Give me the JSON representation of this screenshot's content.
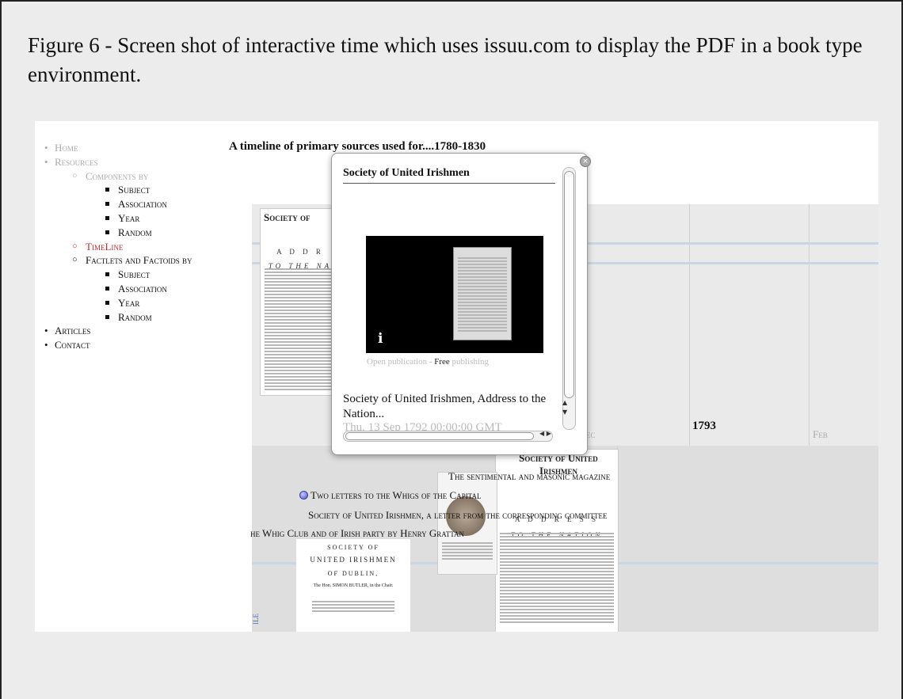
{
  "caption": "Figure 6 - Screen shot of interactive time which uses issuu.com to display the PDF in a book type environment.",
  "nav": {
    "home": "Home",
    "resources": "Resources",
    "components_by": "Components by",
    "components_items": [
      "Subject",
      "Association",
      "Year",
      "Random"
    ],
    "timeline": "TimeLine",
    "factlets": "Factlets and Factoids by",
    "factlets_items": [
      "Subject",
      "Association",
      "Year",
      "Random"
    ],
    "articles": "Articles",
    "contact": "Contact"
  },
  "page_heading": "A timeline of primary sources used for....1780-1830",
  "timeline": {
    "year_label": "1793",
    "month_labels": [
      "ec",
      "Feb"
    ],
    "doc_cards": [
      {
        "title": "Society of",
        "sub": "A D D R",
        "sub2": "TO THE NA"
      },
      {
        "title": "Society of United Irishmen",
        "sub": "A D D R E S S",
        "sub2": "TO THE NATION"
      }
    ],
    "doc3_lines": [
      "SOCIETY OF",
      "UNITED IRISHMEN",
      "OF DUBLIN,",
      "The Hon. SIMON BUTLER, in the Chair."
    ],
    "events": [
      "The sentimental and masonic magazine",
      "Two letters to the Whigs of the Capital",
      "Society of United Irishmen, a letter from the corresponding committee",
      "he Whig Club and of Irish party by Henry Grattan"
    ],
    "side_flag": "ILE"
  },
  "popup": {
    "title": "Society of United Irishmen",
    "info_glyph": "i",
    "open_link": "Open publication",
    "free_label": "Free",
    "publishing_link": "publishing",
    "description": "Society of United Irishmen, Address to the Nation...",
    "date": "Thu, 13 Sep 1792 00:00:00 GMT"
  }
}
